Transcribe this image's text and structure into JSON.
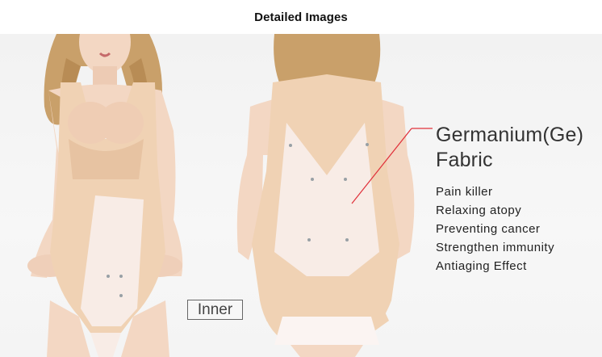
{
  "header": {
    "title": "Detailed Images"
  },
  "labels": {
    "inner": "Inner"
  },
  "callout": {
    "title_line1": "Germanium(Ge)",
    "title_line2": "Fabric",
    "accent_color": "#e0303a",
    "benefits": [
      "Pain killer",
      "Relaxing atopy",
      "Preventing cancer",
      "Strengthen immunity",
      "Antiaging Effect"
    ]
  },
  "colors": {
    "garment_beige": "#f0d2b4",
    "garment_inner": "#f8ece6",
    "skin": "#f3d7c3",
    "hair": "#c9a06a"
  }
}
